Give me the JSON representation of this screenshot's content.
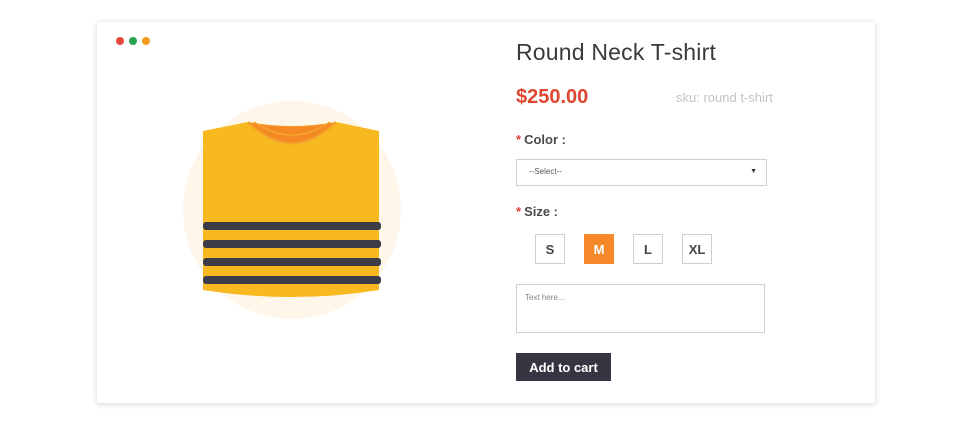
{
  "window": {
    "dots": [
      {
        "name": "close",
        "color": "#e8453c"
      },
      {
        "name": "minimize",
        "color": "#2aa350"
      },
      {
        "name": "maximize",
        "color": "#f19b1f"
      }
    ]
  },
  "product": {
    "image_icon": "striped-t-shirt",
    "title": "Round Neck T-shirt",
    "price": "$250.00",
    "sku": "sku: round t-shirt"
  },
  "form": {
    "color": {
      "required_mark": "*",
      "label": "Color :",
      "selected": "--Select--"
    },
    "size": {
      "required_mark": "*",
      "label": "Size :",
      "options": [
        "S",
        "M",
        "L",
        "XL"
      ],
      "selected": "M"
    },
    "notes": {
      "placeholder": "Text here..."
    },
    "add_to_cart_label": "Add to cart"
  },
  "colors": {
    "accent": "#f5892a",
    "price": "#e0462f",
    "button": "#363643"
  }
}
